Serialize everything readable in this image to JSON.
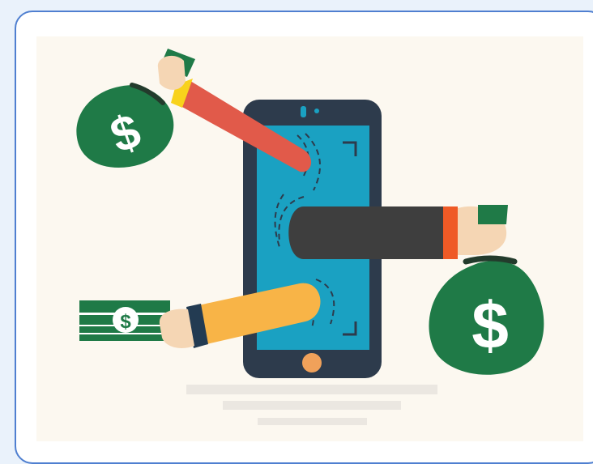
{
  "illustration": {
    "dollar_symbol": "$",
    "colors": {
      "page_background": "#eaf2fb",
      "card_border": "#4f7fd0",
      "canvas_background": "#fcf8f0",
      "phone_body": "#2d3b4c",
      "phone_screen": "#1aa1c2",
      "home_button": "#f0a15a",
      "money_green": "#1f7a47",
      "arm_red": "#e15a4a",
      "arm_dark": "#3e3e3e",
      "arm_yellow": "#f8b447",
      "cuff_yellow": "#f8d21c",
      "cuff_orange": "#ef5a26",
      "cuff_navy": "#233b52",
      "skin": "#f5d6b4"
    }
  }
}
